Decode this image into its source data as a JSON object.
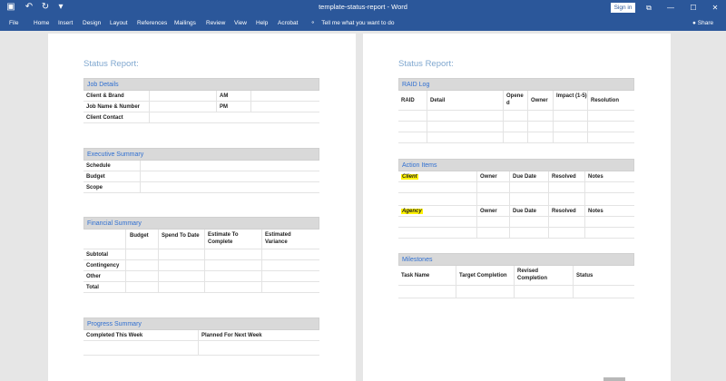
{
  "titlebar": {
    "title": "template-status-report  -  Word",
    "signin_label": "Sign in",
    "icons": [
      "save-icon",
      "undo-icon",
      "redo-icon",
      "customize-icon"
    ]
  },
  "window_controls": {
    "options": "⧉",
    "minimize": "—",
    "maximize": "☐",
    "close": "✕"
  },
  "ribbon": {
    "tabs": [
      "File",
      "Home",
      "Insert",
      "Design",
      "Layout",
      "References",
      "Mailings",
      "Review",
      "View",
      "Help",
      "Acrobat"
    ],
    "tell_me": "Tell me what you want to do",
    "share": "Share"
  },
  "left_page": {
    "title": "Status Report:",
    "job_details": {
      "heading": "Job Details",
      "labels": [
        "Client & Brand",
        "Job Name & Number",
        "Client Contact",
        "AM",
        "PM"
      ]
    },
    "executive_summary": {
      "heading": "Executive Summary",
      "labels": [
        "Schedule",
        "Budget",
        "Scope"
      ]
    },
    "financial_summary": {
      "heading": "Financial Summary",
      "columns": [
        "Budget",
        "Spend To Date",
        "Estimate To Complete",
        "Estimated Variance"
      ],
      "rows": [
        "Subtotal",
        "Contingency",
        "Other",
        "Total"
      ]
    },
    "progress_summary": {
      "heading": "Progress Summary",
      "columns": [
        "Completed This Week",
        "Planned For Next Week"
      ]
    }
  },
  "right_page": {
    "title": "Status Report:",
    "raid_log": {
      "heading": "RAID Log",
      "columns": [
        "RAID",
        "Detail",
        "Opened",
        "Owner",
        "Impact (1-5)",
        "Resolution"
      ]
    },
    "action_items": {
      "heading": "Action Items",
      "groups": [
        "Client",
        "Agency"
      ],
      "columns": [
        "Owner",
        "Due Date",
        "Resolved",
        "Notes"
      ]
    },
    "milestones": {
      "heading": "Milestones",
      "columns": [
        "Task Name",
        "Target Completion",
        "Revised Completion",
        "Status"
      ]
    }
  }
}
